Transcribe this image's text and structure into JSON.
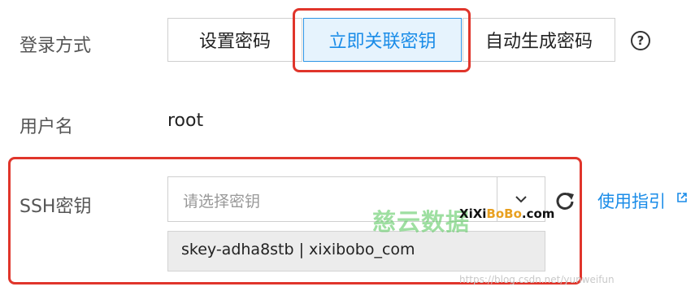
{
  "login": {
    "label": "登录方式",
    "options": [
      "设置密码",
      "立即关联密钥",
      "自动生成密码"
    ],
    "selected": "立即关联密钥",
    "help_icon": "question-circle-icon"
  },
  "username": {
    "label": "用户名",
    "value": "root"
  },
  "ssh": {
    "label": "SSH密钥",
    "placeholder": "请选择密钥",
    "selected_key": "skey-adha8stb | xixibobo_com",
    "guide_link": "使用指引",
    "refresh_icon": "refresh-icon",
    "external_icon": "external-link-icon"
  },
  "watermark": {
    "brand_cn": "慈云数据",
    "brand_en_prefix": "XiXi",
    "brand_en_mid": "BoBo",
    "brand_en_suffix": ".com",
    "url": "https://blog.csdn.net/yunweifun"
  },
  "colors": {
    "accent": "#1a8ce8",
    "highlight": "#e0352b",
    "watermark_green": "#5fcb64"
  }
}
